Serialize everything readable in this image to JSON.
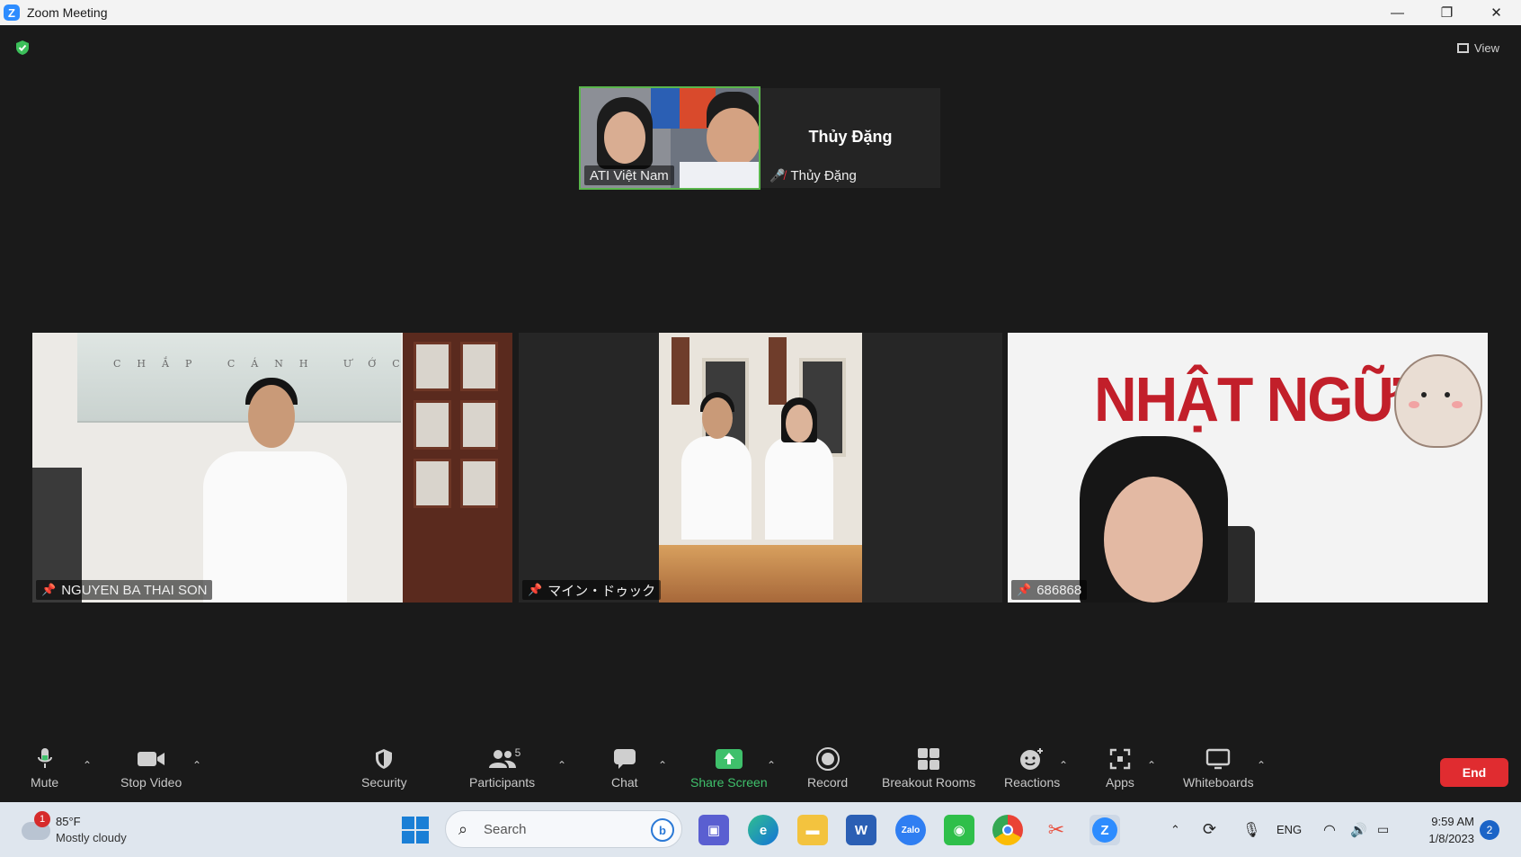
{
  "window": {
    "title": "Zoom Meeting",
    "minimize": "—",
    "restore": "❐",
    "close": "✕"
  },
  "view_button": {
    "label": "View"
  },
  "thumbnails": [
    {
      "name": "ATI Việt Nam"
    },
    {
      "name": "Thủy Đặng",
      "display_name": "Thủy Đặng"
    }
  ],
  "tiles": [
    {
      "name": "NGUYEN BA THAI SON",
      "background_text": "CHẮP CÁNH ƯỚC MƠ"
    },
    {
      "name": "マイン・ドゥック"
    },
    {
      "name": "686868",
      "background_text": "NHẬT NGỮ"
    }
  ],
  "toolbar": {
    "mute": "Mute",
    "stop_video": "Stop Video",
    "security": "Security",
    "participants": "Participants",
    "participants_count": "5",
    "chat": "Chat",
    "share_screen": "Share Screen",
    "record": "Record",
    "breakout_rooms": "Breakout Rooms",
    "reactions": "Reactions",
    "apps": "Apps",
    "whiteboards": "Whiteboards",
    "end": "End"
  },
  "taskbar": {
    "weather_alert": "1",
    "temperature": "85°F",
    "condition": "Mostly cloudy",
    "search_placeholder": "Search",
    "language": "ENG",
    "time": "9:59 AM",
    "date": "1/8/2023",
    "notifications": "2"
  },
  "colors": {
    "meeting_bg": "#1a1a1a",
    "active_speaker_border": "#5ab64c",
    "share_green": "#3fc06b",
    "end_red": "#e02c30",
    "taskbar_bg": "#dfe6ee"
  }
}
